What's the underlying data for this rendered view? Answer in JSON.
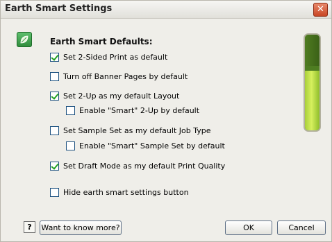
{
  "window": {
    "title": "Earth Smart Settings",
    "close_label": "✕"
  },
  "section": {
    "title": "Earth Smart Defaults:"
  },
  "options": [
    {
      "label": "Set 2-Sided Print as default",
      "checked": true
    },
    {
      "label": "Turn off Banner Pages by default",
      "checked": false
    },
    {
      "label": "Set 2-Up as my default Layout",
      "checked": true
    },
    {
      "label": "Enable \"Smart\" 2-Up by default",
      "checked": false
    },
    {
      "label": "Set Sample Set as my default Job Type",
      "checked": false
    },
    {
      "label": "Enable \"Smart\" Sample Set by default",
      "checked": false
    },
    {
      "label": "Set Draft Mode as my default Print Quality",
      "checked": true
    },
    {
      "label": "Hide earth smart settings button",
      "checked": false
    }
  ],
  "gauge": {
    "level": 0.62,
    "colors": {
      "empty": "#4e7d22",
      "fill": "#c4e24c"
    }
  },
  "footer": {
    "help_label": "?",
    "know_more_label": "Want to know more?",
    "ok_label": "OK",
    "cancel_label": "Cancel"
  },
  "icons": {
    "app": "leaf-icon",
    "close": "close-icon",
    "help": "help-icon"
  }
}
